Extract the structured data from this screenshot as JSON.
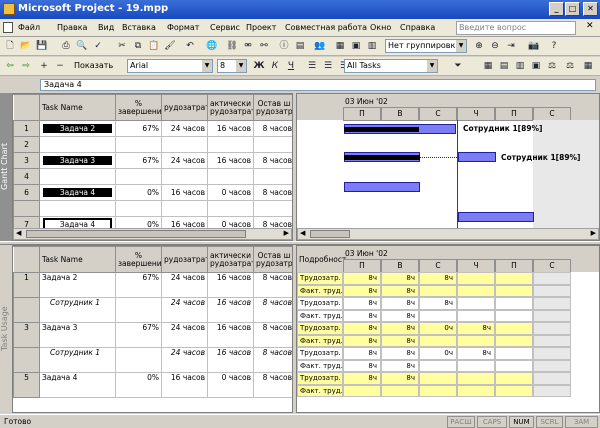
{
  "window": {
    "title": "Microsoft Project - 19.mpp",
    "minimize": "_",
    "maximize": "□",
    "close": "✕"
  },
  "menu": [
    "Файл",
    "Правка",
    "Вид",
    "Вставка",
    "Формат",
    "Сервис",
    "Проект",
    "Совместная работа",
    "Окно",
    "Справка"
  ],
  "help_placeholder": "Введите вопрос",
  "toolbar1": {
    "grouping": "Нет группировки"
  },
  "toolbar2": {
    "show": "Показать",
    "font": "Arial",
    "size": "8",
    "bold": "Ж",
    "italic": "К",
    "underline": "Ч",
    "filter": "All Tasks"
  },
  "entry_value": "Задача 4",
  "gantt": {
    "side_label": "Gantt Chart",
    "headers": [
      "Task Name",
      "% завершения",
      "Трудозатраты",
      "Фактические трудозатраты",
      "Оставшиеся трудозатраты"
    ],
    "header_short": [
      "Task Name",
      "% завершения",
      "рудозатрат",
      "актически рудозатрат",
      "Остав ш рудозатрат"
    ],
    "rows": [
      {
        "id": "1",
        "name": "Задача 2",
        "pct": "67%",
        "work": "24 часов",
        "actual": "16 часов",
        "remain": "8 часов",
        "black": true
      },
      {
        "id": "2",
        "name": "",
        "pct": "",
        "work": "",
        "actual": "",
        "remain": "",
        "black": false
      },
      {
        "id": "3",
        "name": "Задача 3",
        "pct": "67%",
        "work": "24 часов",
        "actual": "16 часов",
        "remain": "8 часов",
        "black": true
      },
      {
        "id": "4",
        "name": "",
        "pct": "",
        "work": "",
        "actual": "",
        "remain": "",
        "black": false
      },
      {
        "id": "6",
        "name": "Задача 4",
        "pct": "0%",
        "work": "16 часов",
        "actual": "0 часов",
        "remain": "8 часов",
        "black": true
      },
      {
        "id": "",
        "name": "",
        "pct": "",
        "work": "",
        "actual": "",
        "remain": "",
        "black": false
      },
      {
        "id": "7",
        "name": "Задача 4",
        "pct": "0%",
        "work": "16 часов",
        "actual": "0 часов",
        "remain": "8 часов",
        "black": false
      },
      {
        "id": "",
        "name": "",
        "pct": "",
        "work": "",
        "actual": "",
        "remain": "",
        "black": false
      }
    ],
    "week": "03 Июн '02",
    "days": [
      "П",
      "В",
      "С",
      "Ч",
      "П",
      "С"
    ],
    "labels": [
      "Сотрудник 1[89%]",
      "Сотрудник 1[89%]"
    ]
  },
  "usage": {
    "side_label": "Task Usage",
    "header_short": [
      "Task Name",
      "% завершения",
      "рудозатрат",
      "актически рудозатрат",
      "Остав ш рудозатрат"
    ],
    "details_header": "Подробност",
    "rows": [
      {
        "id": "1",
        "name": "Задача 2",
        "pct": "67%",
        "work": "24 часов",
        "actual": "16 часов",
        "remain": "8 часов",
        "italic": false
      },
      {
        "id": "",
        "name": "Сотрудник 1",
        "pct": "",
        "work": "24 часов",
        "actual": "16 часов",
        "remain": "8 часов",
        "italic": true
      },
      {
        "id": "3",
        "name": "Задача 3",
        "pct": "67%",
        "work": "24 часов",
        "actual": "16 часов",
        "remain": "8 часов",
        "italic": false
      },
      {
        "id": "",
        "name": "Сотрудник 1",
        "pct": "",
        "work": "24 часов",
        "actual": "16 часов",
        "remain": "8 часов",
        "italic": true
      },
      {
        "id": "5",
        "name": "Задача 4",
        "pct": "0%",
        "work": "16 часов",
        "actual": "0 часов",
        "remain": "8 часов",
        "italic": false
      }
    ],
    "detail_rows": [
      {
        "label": "Трудозатр.",
        "vals": [
          "8ч",
          "8ч",
          "8ч",
          "",
          ""
        ],
        "yellow": true
      },
      {
        "label": "Факт. труд.",
        "vals": [
          "8ч",
          "8ч",
          "",
          "",
          ""
        ],
        "yellow": true
      },
      {
        "label": "Трудозатр.",
        "vals": [
          "8ч",
          "8ч",
          "8ч",
          "",
          ""
        ],
        "yellow": false
      },
      {
        "label": "Факт. труд.",
        "vals": [
          "8ч",
          "8ч",
          "",
          "",
          ""
        ],
        "yellow": false
      },
      {
        "label": "Трудозатр.",
        "vals": [
          "8ч",
          "8ч",
          "0ч",
          "8ч",
          ""
        ],
        "yellow": true
      },
      {
        "label": "Факт. труд.",
        "vals": [
          "8ч",
          "8ч",
          "",
          "",
          ""
        ],
        "yellow": true
      },
      {
        "label": "Трудозатр.",
        "vals": [
          "8ч",
          "8ч",
          "0ч",
          "8ч",
          ""
        ],
        "yellow": false
      },
      {
        "label": "Факт. труд.",
        "vals": [
          "8ч",
          "8ч",
          "",
          "",
          ""
        ],
        "yellow": false
      },
      {
        "label": "Трудозатр.",
        "vals": [
          "8ч",
          "8ч",
          "",
          "",
          ""
        ],
        "yellow": true
      },
      {
        "label": "Факт. труд.",
        "vals": [
          "",
          "",
          "",
          "",
          ""
        ],
        "yellow": true
      }
    ]
  },
  "status": {
    "ready": "Готово",
    "caps_ext": "РАСШ",
    "caps": "CAPS",
    "num": "NUM",
    "scrl": "SCRL",
    "zam": "ЗАМ"
  }
}
